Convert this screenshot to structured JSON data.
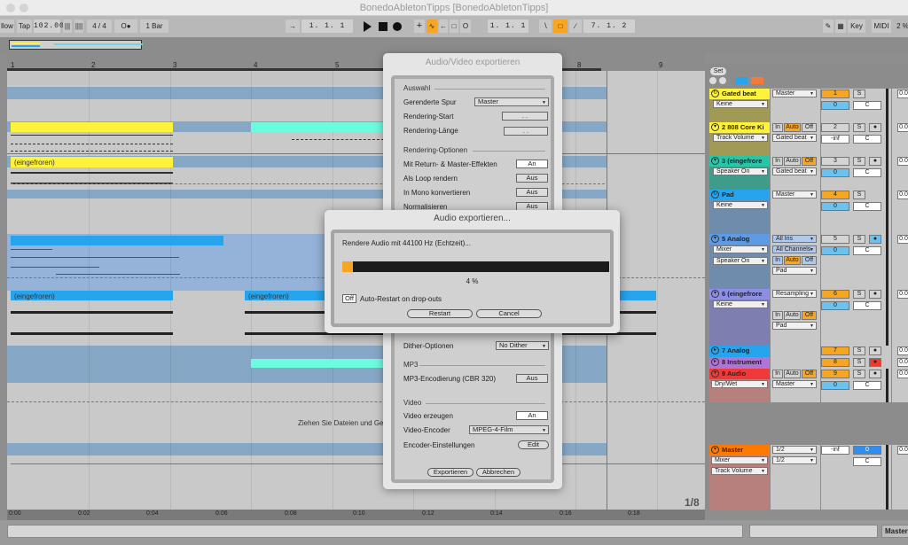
{
  "window": {
    "title": "BonedoAbletonTipps  [BonedoAbletonTipps]"
  },
  "toolbar": {
    "follow": "llow",
    "tap": "Tap",
    "tempo": "102.00",
    "time_sig": "4 / 4",
    "metronome": "O●",
    "quantize": "1 Bar",
    "arrangement_position": "1.  1.  1",
    "loop_start": "1.  1.  1",
    "loop_length": "7.  1.  2",
    "key": "Key",
    "midi": "MIDI",
    "cpu": "2 %",
    "icons": [
      "play-icon",
      "stop-icon",
      "record-icon",
      "add-icon",
      "automation-arm-icon",
      "back-to-arrangement-icon",
      "capture-icon",
      "session-record-icon",
      "punch-in-icon",
      "loop-icon",
      "punch-out-icon",
      "draw-mode-icon",
      "computer-keyboard-icon"
    ]
  },
  "ruler": {
    "bars": [
      "1",
      "2",
      "3",
      "4",
      "5",
      "8",
      "9"
    ]
  },
  "arrangement": {
    "clips": [
      {
        "label": "(eingefroren)",
        "color": "#fff23a"
      },
      {
        "label": "(eingefroren)",
        "color": "#26a5ee"
      },
      {
        "label": "(eingefroren)",
        "color": "#26a5ee"
      }
    ],
    "drop_hint": "Ziehen Sie Dateien und Gerä",
    "zoom_label": "1/8"
  },
  "timeline": {
    "ticks": [
      "0:00",
      "0:02",
      "0:04",
      "0:06",
      "0:08",
      "0:10",
      "0:12",
      "0:14",
      "0:16",
      "0:18"
    ]
  },
  "mixer": {
    "set_label": "Set",
    "tracks": [
      {
        "name": "Gated beat",
        "color": "#fff23a",
        "body": "#a19a57",
        "device": "Keine",
        "output": "Master",
        "number": "1",
        "vol": "0",
        "pan": "C",
        "solo": "S",
        "peak": "0.0"
      },
      {
        "name": "2 808 Core Ki",
        "color": "#fff23a",
        "body": "#a19a57",
        "device": "Track Volume",
        "monitor": [
          "In",
          "Auto",
          "Off"
        ],
        "output": "Gated beat",
        "number": "2",
        "vol": "-inf",
        "pan": "C",
        "solo": "S",
        "peak": "0.0"
      },
      {
        "name": "3  (eingefrore",
        "color": "#26c6a8",
        "body": "#3f9b8a",
        "device": "Speaker On",
        "monitor": [
          "In",
          "Auto",
          "Off"
        ],
        "output": "Gated beat",
        "number": "3",
        "vol": "0",
        "pan": "C",
        "solo": "S",
        "peak": "0.0"
      },
      {
        "name": "Pad",
        "color": "#26a5ee",
        "body": "#6f8cad",
        "device": "Keine",
        "output": "Master",
        "number": "4",
        "vol": "0",
        "pan": "C",
        "solo": "S",
        "peak": "0.0"
      },
      {
        "name": "5 Analog",
        "color": "#5e9be6",
        "body": "#6f8cad",
        "device": "Mixer",
        "device2": "Speaker On",
        "input": "All Ins",
        "channel": "All Channels",
        "monitor": [
          "In",
          "Auto",
          "Off"
        ],
        "output": "Pad",
        "number": "5",
        "vol": "0",
        "pan": "C",
        "solo": "S",
        "peak": "0.0"
      },
      {
        "name": "6  (eingefrore",
        "color": "#8c8ee8",
        "body": "#7e7fb0",
        "device": "Keine",
        "input": "Resampling",
        "monitor": [
          "In",
          "Auto",
          "Off"
        ],
        "output": "Pad",
        "number": "6",
        "vol": "0",
        "pan": "C",
        "solo": "S",
        "peak": "0.0"
      },
      {
        "name": "7 Analog",
        "color": "#26a5ee",
        "number": "7",
        "solo": "S",
        "peak": "0.0"
      },
      {
        "name": "8 Instrument",
        "color": "#b073d6",
        "number": "8",
        "solo": "S",
        "peak": "0.0"
      },
      {
        "name": "9 Audio",
        "color": "#f03a3a",
        "body": "#b7807c",
        "device": "Dry/Wet",
        "monitor": [
          "In",
          "Auto",
          "Off"
        ],
        "output": "Master",
        "number": "9",
        "vol": "0",
        "pan": "C",
        "solo": "S",
        "peak": "0.0"
      }
    ],
    "master": {
      "name": "Master",
      "color": "#ff7a00",
      "body": "#b7807c",
      "device": "Mixer",
      "device2": "Track Volume",
      "cue_out": "1/2",
      "master_out": "1/2",
      "cue_vol": "-inf",
      "vol": "0",
      "pan": "C",
      "peak": "0.0"
    }
  },
  "bottom": {
    "track_label": "Master"
  },
  "av_dialog": {
    "title": "Audio/Video exportieren",
    "section_selection": "Auswahl",
    "rendered_track_label": "Gerenderte Spur",
    "rendered_track_value": "Master",
    "render_start_label": "Rendering-Start",
    "render_start_value": ".   .",
    "render_length_label": "Rendering-Länge",
    "render_length_value": ".   .",
    "section_options": "Rendering-Optionen",
    "return_master_label": "Mit Return- & Master-Effekten",
    "return_master_value": "An",
    "loop_label": "Als Loop rendern",
    "loop_value": "Aus",
    "mono_label": "In Mono konvertieren",
    "mono_value": "Aus",
    "normalize_label": "Normalisieren",
    "normalize_value": "Aus",
    "dither_label": "Dither-Optionen",
    "dither_value": "No Dither",
    "section_mp3": "MP3",
    "mp3_label": "MP3-Encodierung (CBR 320)",
    "mp3_value": "Aus",
    "section_video": "Video",
    "video_create_label": "Video erzeugen",
    "video_create_value": "An",
    "video_encoder_label": "Video-Encoder",
    "video_encoder_value": "MPEG-4-Film",
    "encoder_settings_label": "Encoder-Einstellungen",
    "encoder_settings_button": "Edit",
    "export_button": "Exportieren",
    "cancel_button": "Abbrechen"
  },
  "progress_dialog": {
    "title": "Audio exportieren...",
    "status": "Rendere Audio mit 44100 Hz (Echtzeit)...",
    "progress_percent": 4,
    "progress_label": "4 %",
    "auto_restart_toggle": "Off",
    "auto_restart_label": "Auto-Restart on drop-outs",
    "restart_button": "Restart",
    "cancel_button": "Cancel",
    "accent": "#f6a623"
  }
}
